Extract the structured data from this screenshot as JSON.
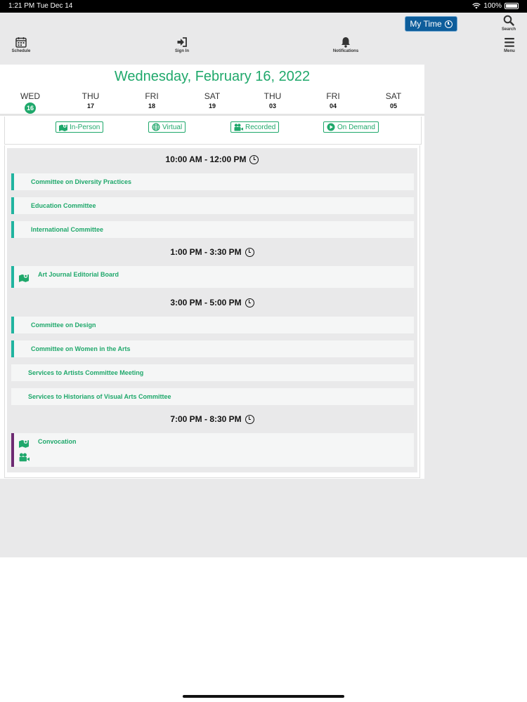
{
  "status_bar": {
    "time": "1:21 PM",
    "date": "Tue Dec 14",
    "battery": "100%"
  },
  "toolbar": {
    "my_time_label": "My Time",
    "search_label": "Search",
    "schedule_label": "Schedule",
    "signin_label": "Sign In",
    "notifications_label": "Notifications",
    "menu_label": "Menu"
  },
  "header": {
    "date_title": "Wednesday, February 16, 2022"
  },
  "days": [
    {
      "name": "WED",
      "num": "16"
    },
    {
      "name": "THU",
      "num": "17"
    },
    {
      "name": "FRI",
      "num": "18"
    },
    {
      "name": "SAT",
      "num": "19"
    },
    {
      "name": "THU",
      "num": "03"
    },
    {
      "name": "FRI",
      "num": "04"
    },
    {
      "name": "SAT",
      "num": "05"
    }
  ],
  "filters": [
    "In-Person",
    "Virtual",
    "Recorded",
    "On Demand"
  ],
  "timeslots": [
    {
      "time": "10:00 AM - 12:00 PM",
      "sessions": [
        "Committee on Diversity Practices",
        "Education Committee",
        "International Committee"
      ]
    },
    {
      "time": "1:00 PM - 3:30 PM",
      "sessions": [
        "Art Journal Editorial Board"
      ]
    },
    {
      "time": "3:00 PM - 5:00 PM",
      "sessions": [
        "Committee on Design",
        "Committee on Women in the Arts",
        "Services to Artists Committee Meeting",
        "Services to Historians of Visual Arts Committee"
      ]
    },
    {
      "time": "7:00 PM - 8:30 PM",
      "sessions": [
        "Convocation"
      ]
    }
  ],
  "colors": {
    "accent": "#1fa86b",
    "teal_bar": "#20b4a0",
    "purple_bar": "#6d2a72",
    "my_time_bg": "#0d5d9b"
  }
}
